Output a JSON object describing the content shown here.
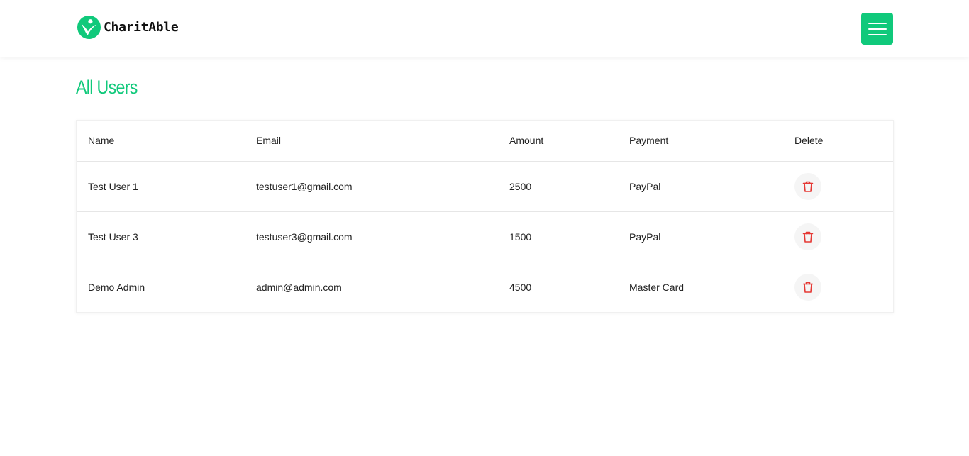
{
  "brand": {
    "name": "CharitAble",
    "logo_icon": "charity-person-icon",
    "accent_color": "#10c97b"
  },
  "header": {
    "menu_icon": "hamburger-menu-icon"
  },
  "page": {
    "title": "All Users"
  },
  "users_table": {
    "headers": {
      "name": "Name",
      "email": "Email",
      "amount": "Amount",
      "payment": "Payment",
      "delete": "Delete"
    },
    "rows": [
      {
        "name": "Test User 1",
        "email": "testuser1@gmail.com",
        "amount": "2500",
        "payment": "PayPal"
      },
      {
        "name": "Test User 3",
        "email": "testuser3@gmail.com",
        "amount": "1500",
        "payment": "PayPal"
      },
      {
        "name": "Demo Admin",
        "email": "admin@admin.com",
        "amount": "4500",
        "payment": "Master Card"
      }
    ],
    "delete_icon": "trash-icon",
    "delete_color": "#e53935"
  }
}
